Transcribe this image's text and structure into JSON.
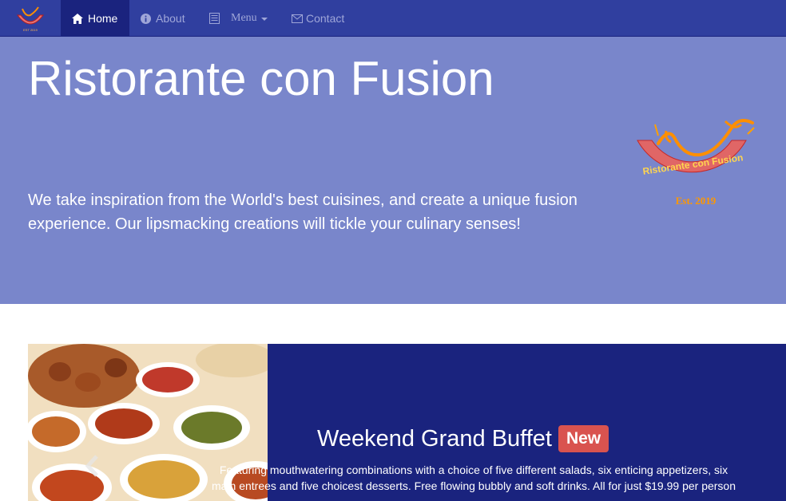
{
  "navbar": {
    "brand_logo_icon": "restaurant-logo-icon",
    "items": [
      {
        "label": "Home",
        "icon": "home-icon",
        "active": true
      },
      {
        "label": "About",
        "icon": "info-icon",
        "active": false
      },
      {
        "label": "Menu",
        "icon": "list-icon",
        "active": false
      },
      {
        "label": "Contact",
        "icon": "envelope-icon",
        "active": false
      }
    ]
  },
  "jumbotron": {
    "title": "Ristorante con Fusion",
    "description": "We take inspiration from the World's best cuisines, and create a unique fusion experience. Our lipsmacking creations will tickle your culinary senses!",
    "logo_text": "Ristorante con Fusion",
    "logo_est": "Est. 2019"
  },
  "carousel": {
    "title": "Weekend Grand Buffet",
    "badge": "New",
    "description": "Featuring mouthwatering combinations with a choice of five different salads, six enticing appetizers, six main entrees and five choicest desserts. Free flowing bubbly and soft drinks. All for just $19.99 per person"
  },
  "colors": {
    "navbar": "#303f9f",
    "navbar_active": "#1a237e",
    "jumbotron": "#7986cb",
    "carousel": "#1a237e",
    "badge": "#d9534f"
  }
}
